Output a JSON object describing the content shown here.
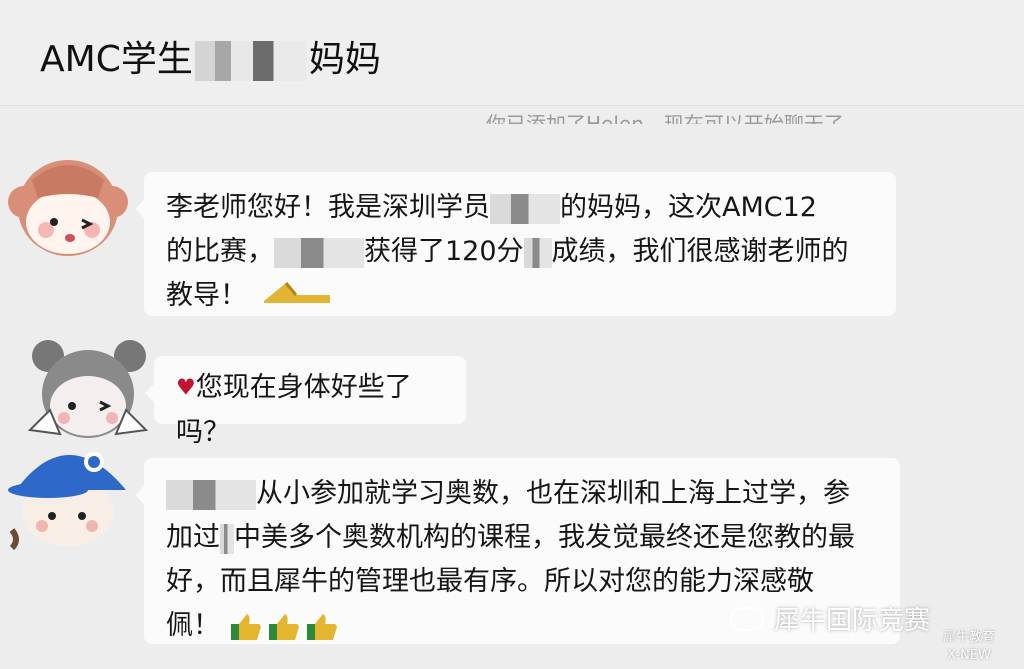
{
  "header": {
    "title_prefix": "AMC学生",
    "title_suffix": "妈妈"
  },
  "system_notice": "你已添加了Helen，现在可以开始聊天了。",
  "messages": [
    {
      "lines": [
        "李老师您好！我是深圳学员",
        "的妈妈，这次AMC12",
        "的比赛，",
        "获得了120分",
        "成绩，我们很感谢老师的",
        "教导！"
      ]
    },
    {
      "text": "您现在身体好些了吗？"
    },
    {
      "lines": [
        "从小参加就学习奥数，也在深圳和上海上过学，参",
        "加过",
        "中美多个奥数机构的课程，我发觉最终还是您教的最",
        "好，而且犀牛的管理也最有序。所以对您的能力深感敬",
        "佩！"
      ]
    }
  ],
  "watermark": {
    "text": "犀牛国际竞赛",
    "logo_top": "犀牛教育",
    "logo_bottom": "X-NEW"
  },
  "icons": [
    "avatar-girl-1",
    "avatar-girl-2",
    "avatar-boy-cap",
    "bread-emoji",
    "thumbs-up-emoji",
    "wechat-official-account-icon",
    "rhino-education-logo"
  ]
}
